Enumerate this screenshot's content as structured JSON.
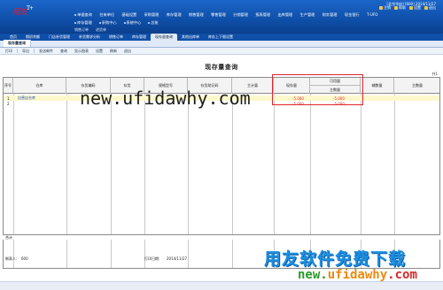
{
  "brand": {
    "mark": "用友",
    "badge": "T+"
  },
  "header": {
    "user_info": "[北京华府] [600] 2014/11/27",
    "tools": [
      "注销",
      "帮助",
      "设置",
      "退出"
    ]
  },
  "menu_row1": [
    "单据查询",
    "往来单位",
    "基础设置",
    "采购管理",
    "库存管理",
    "销售管理",
    "零售管理",
    "分销管理",
    "报表管理",
    "出库管理",
    "生产管理",
    "财务管理",
    "现金银行",
    "T-UFO"
  ],
  "menu_row2": [
    "库存管理",
    "采购中心",
    "系统中心",
    "总账"
  ],
  "menu_row1_sub": [
    "销售订单",
    "进货单"
  ],
  "doc_tabs": [
    "首页",
    "期初余额",
    "门店补货管理",
    "补货需求分析",
    "销售订单",
    "库存管理",
    "现存量查询",
    "其他出库单",
    "库存上下限设置"
  ],
  "active_doc_tab": "现存量查询",
  "toolbar": [
    "打印",
    "导出",
    "发送邮件",
    "查询",
    "显示图表",
    "设置",
    "刷新",
    "退出"
  ],
  "report": {
    "title": "现存量查询",
    "page_hint": "共1",
    "columns": {
      "seq": "序号",
      "warehouse": "仓库",
      "inv_code": "存货编码",
      "inv_name": "存货",
      "spec": "规格型号",
      "helper": "存货助记码",
      "unit": "主计量",
      "onhand": "现存量",
      "avail_group": "可用量",
      "avail_main": "主数量",
      "aux": "辅数量",
      "main_qty": "主数量"
    },
    "rows": [
      {
        "seq": "1",
        "warehouse": "自营店仓库",
        "inv_code": "",
        "inv_name": "",
        "spec": "",
        "helper": "",
        "unit": "",
        "onhand": "-5.000",
        "avail": "-5.000"
      },
      {
        "seq": "2",
        "warehouse": "",
        "inv_code": "",
        "inv_name": "",
        "spec": "",
        "helper": "",
        "unit": "",
        "onhand": "-5.000",
        "avail": "-5.000"
      }
    ],
    "total_label": "合计",
    "footer": {
      "maker_label": "制表人:",
      "maker": "600",
      "print_date_label": "打印日期:",
      "print_date": "2014/11/27"
    }
  },
  "watermarks": {
    "center_url": "new.ufidawhy.com",
    "cn_slogan": "用友软件免费下载",
    "url_a": "new.",
    "url_b": "ufidawhy",
    "url_c": ".com"
  }
}
